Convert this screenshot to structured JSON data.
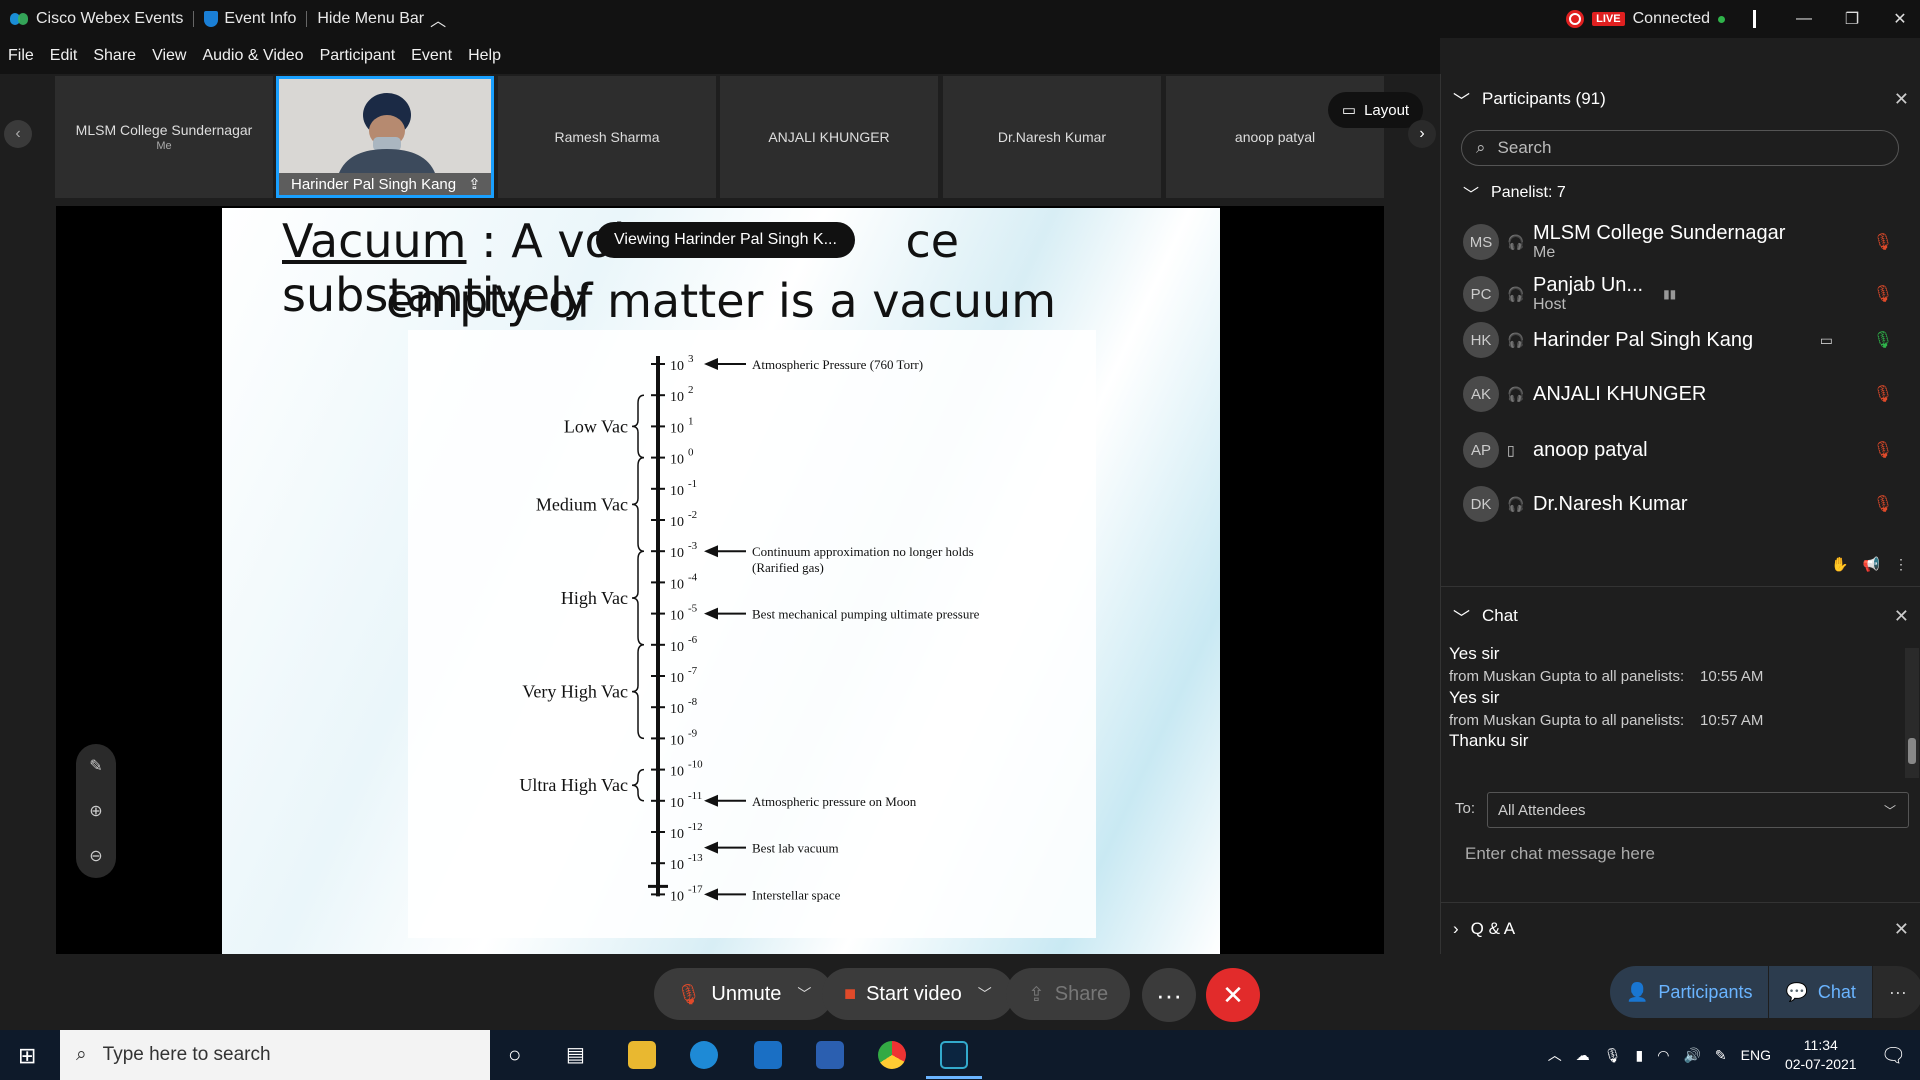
{
  "titlebar": {
    "app": "Cisco Webex Events",
    "event_info": "Event Info",
    "hide_menu": "Hide Menu Bar",
    "live": "LIVE",
    "status": "Connected"
  },
  "menu": [
    "File",
    "Edit",
    "Share",
    "View",
    "Audio & Video",
    "Participant",
    "Event",
    "Help"
  ],
  "strip": {
    "tiles": [
      {
        "name": "MLSM College Sundernagar",
        "sub": "Me"
      },
      {
        "name": "Harinder Pal Singh Kang",
        "sub": ""
      },
      {
        "name": "Ramesh Sharma",
        "sub": ""
      },
      {
        "name": "ANJALI KHUNGER",
        "sub": ""
      },
      {
        "name": "Dr.Naresh Kumar",
        "sub": ""
      },
      {
        "name": "anoop patyal",
        "sub": ""
      }
    ],
    "layout": "Layout"
  },
  "slide": {
    "title_underlined": "Vacuum",
    "title_rest": " : A vol",
    "title_rest2": "ce substantively",
    "title_line2": "empty of matter is a vacuum",
    "viewing": "Viewing Harinder Pal Singh K..."
  },
  "diagram": {
    "base": "10",
    "ticks": [
      {
        "exp": "3",
        "v": 3
      },
      {
        "exp": "2",
        "v": 2
      },
      {
        "exp": "1",
        "v": 1
      },
      {
        "exp": "0",
        "v": 0
      },
      {
        "exp": "-1",
        "v": -1
      },
      {
        "exp": "-2",
        "v": -2
      },
      {
        "exp": "-3",
        "v": -3
      },
      {
        "exp": "-4",
        "v": -4
      },
      {
        "exp": "-5",
        "v": -5
      },
      {
        "exp": "-6",
        "v": -6
      },
      {
        "exp": "-7",
        "v": -7
      },
      {
        "exp": "-8",
        "v": -8
      },
      {
        "exp": "-9",
        "v": -9
      },
      {
        "exp": "-10",
        "v": -10
      },
      {
        "exp": "-11",
        "v": -11
      },
      {
        "exp": "-12",
        "v": -12
      },
      {
        "exp": "-13",
        "v": -13
      },
      {
        "exp": "-17",
        "v": -17
      }
    ],
    "ranges": [
      {
        "label": "Low Vac",
        "from": 2,
        "to": 0
      },
      {
        "label": "Medium Vac",
        "from": 0,
        "to": -3
      },
      {
        "label": "High Vac",
        "from": -3,
        "to": -6
      },
      {
        "label": "Very High Vac",
        "from": -6,
        "to": -9
      },
      {
        "label": "Ultra High Vac",
        "from": -10,
        "to": -11
      }
    ],
    "notes": [
      {
        "at": 3,
        "text": "Atmospheric Pressure (760 Torr)",
        "text2": ""
      },
      {
        "at": -3,
        "text": "Continuum approximation no longer holds",
        "text2": "(Rarified gas)"
      },
      {
        "at": -5,
        "text": "Best mechanical pumping ultimate pressure",
        "text2": ""
      },
      {
        "at": -11,
        "text": "Atmospheric pressure on Moon",
        "text2": ""
      },
      {
        "at": -12.5,
        "text": "Best lab vacuum",
        "text2": ""
      },
      {
        "at": -17,
        "text": "Interstellar space",
        "text2": ""
      }
    ]
  },
  "controls": {
    "unmute": "Unmute",
    "start_video": "Start video",
    "share": "Share"
  },
  "participants": {
    "header": "Participants (91)",
    "search_placeholder": "Search",
    "panelist_header": "Panelist: 7",
    "rows": [
      {
        "initials": "MS",
        "name": "MLSM College Sundernagar",
        "role": "Me"
      },
      {
        "initials": "PC",
        "name": "Panjab Un...",
        "role": "Host"
      },
      {
        "initials": "HK",
        "name": "Harinder Pal Singh Kang",
        "role": ""
      },
      {
        "initials": "AK",
        "name": "ANJALI KHUNGER",
        "role": ""
      },
      {
        "initials": "AP",
        "name": "anoop patyal",
        "role": ""
      },
      {
        "initials": "DK",
        "name": "Dr.Naresh Kumar",
        "role": ""
      }
    ]
  },
  "chat": {
    "header": "Chat",
    "messages": [
      {
        "text": "Yes sir",
        "meta": "from Muskan Gupta to all panelists:",
        "time": "10:55 AM"
      },
      {
        "text": "Yes sir",
        "meta": "from Muskan Gupta to all panelists:",
        "time": "10:57 AM"
      },
      {
        "text": "Thanku sir",
        "meta": "",
        "time": ""
      }
    ],
    "to_label": "To:",
    "to_value": "All Attendees",
    "input_placeholder": "Enter chat message here"
  },
  "qa": {
    "header": "Q & A"
  },
  "bottom_tabs": {
    "participants": "Participants",
    "chat": "Chat"
  },
  "taskbar": {
    "search_placeholder": "Type here to search",
    "lang": "ENG",
    "time": "11:34",
    "date": "02-07-2021"
  }
}
